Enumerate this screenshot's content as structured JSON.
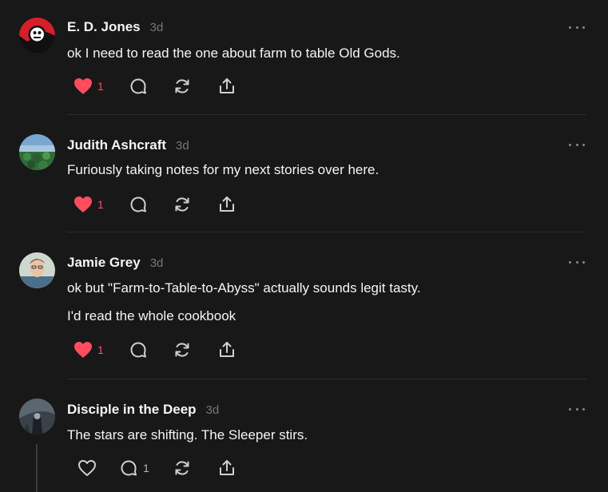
{
  "posts": [
    {
      "author": "E. D. Jones",
      "time": "3d",
      "lines": [
        "ok I need to read the one about farm to table Old Gods."
      ],
      "likes": "1",
      "liked": true,
      "replies": ""
    },
    {
      "author": "Judith Ashcraft",
      "time": "3d",
      "lines": [
        "Furiously taking notes for my next stories over here."
      ],
      "likes": "1",
      "liked": true,
      "replies": ""
    },
    {
      "author": "Jamie Grey",
      "time": "3d",
      "lines": [
        "ok but \"Farm-to-Table-to-Abyss\" actually sounds legit tasty.",
        "I'd read the whole cookbook"
      ],
      "likes": "1",
      "liked": true,
      "replies": ""
    },
    {
      "author": "Disciple in the Deep",
      "time": "3d",
      "lines": [
        "The stars are shifting. The Sleeper stirs."
      ],
      "likes": "",
      "liked": false,
      "replies": "1"
    }
  ],
  "colors": {
    "like": "#ff4d5e",
    "background": "#181818",
    "text": "#f3f5f7",
    "muted": "#777777"
  },
  "icons": {
    "like": "heart-icon",
    "reply": "comment-icon",
    "repost": "repost-icon",
    "share": "share-icon",
    "more": "more-icon"
  }
}
